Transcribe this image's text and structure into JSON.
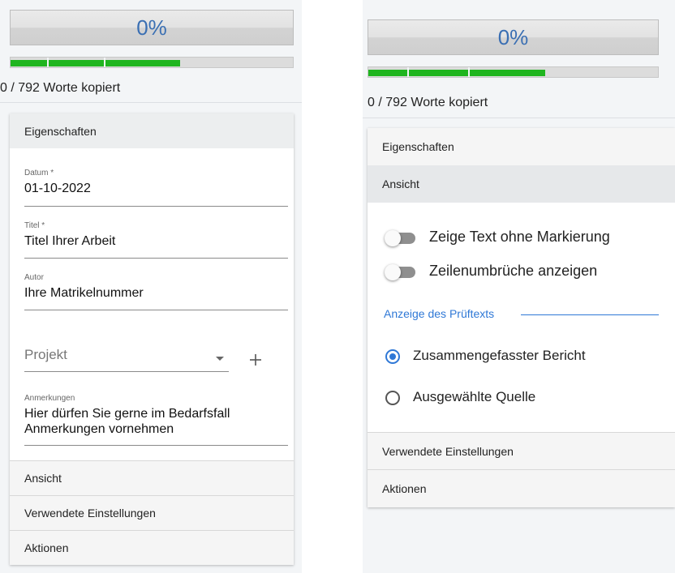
{
  "left": {
    "progress_percent": "0%",
    "progress_fraction": 0.6,
    "words_copied": "0 / 792 Worte kopiert",
    "sections": {
      "properties": "Eigenschaften",
      "view": "Ansicht",
      "used_settings": "Verwendete Einstellungen",
      "actions": "Aktionen"
    },
    "fields": {
      "date_label": "Datum *",
      "date_value": "01-10-2022",
      "title_label": "Titel *",
      "title_value": "Titel Ihrer Arbeit",
      "author_label": "Autor",
      "author_value": "Ihre Matrikelnummer",
      "project_placeholder": "Projekt",
      "notes_label": "Anmerkungen",
      "notes_value": "Hier dürfen Sie gerne im Bedarfsfall Anmerkungen vornehmen"
    }
  },
  "right": {
    "progress_percent": "0%",
    "progress_fraction": 0.61,
    "words_copied": "0 / 792 Worte kopiert",
    "sections": {
      "properties": "Eigenschaften",
      "view": "Ansicht",
      "used_settings": "Verwendete Einstellungen",
      "actions": "Aktionen"
    },
    "view": {
      "toggle_no_marking": "Zeige Text ohne Markierung",
      "toggle_line_breaks": "Zeilenumbrüche anzeigen",
      "display_heading": "Anzeige des Prüftexts",
      "radio_summary": "Zusammengefasster Bericht",
      "radio_source": "Ausgewählte Quelle",
      "selected": "Zusammengefasster Bericht"
    }
  },
  "colors": {
    "accent": "#2f78d6",
    "progress_green": "#1fb51f",
    "percent_text": "#3a6fb3"
  }
}
